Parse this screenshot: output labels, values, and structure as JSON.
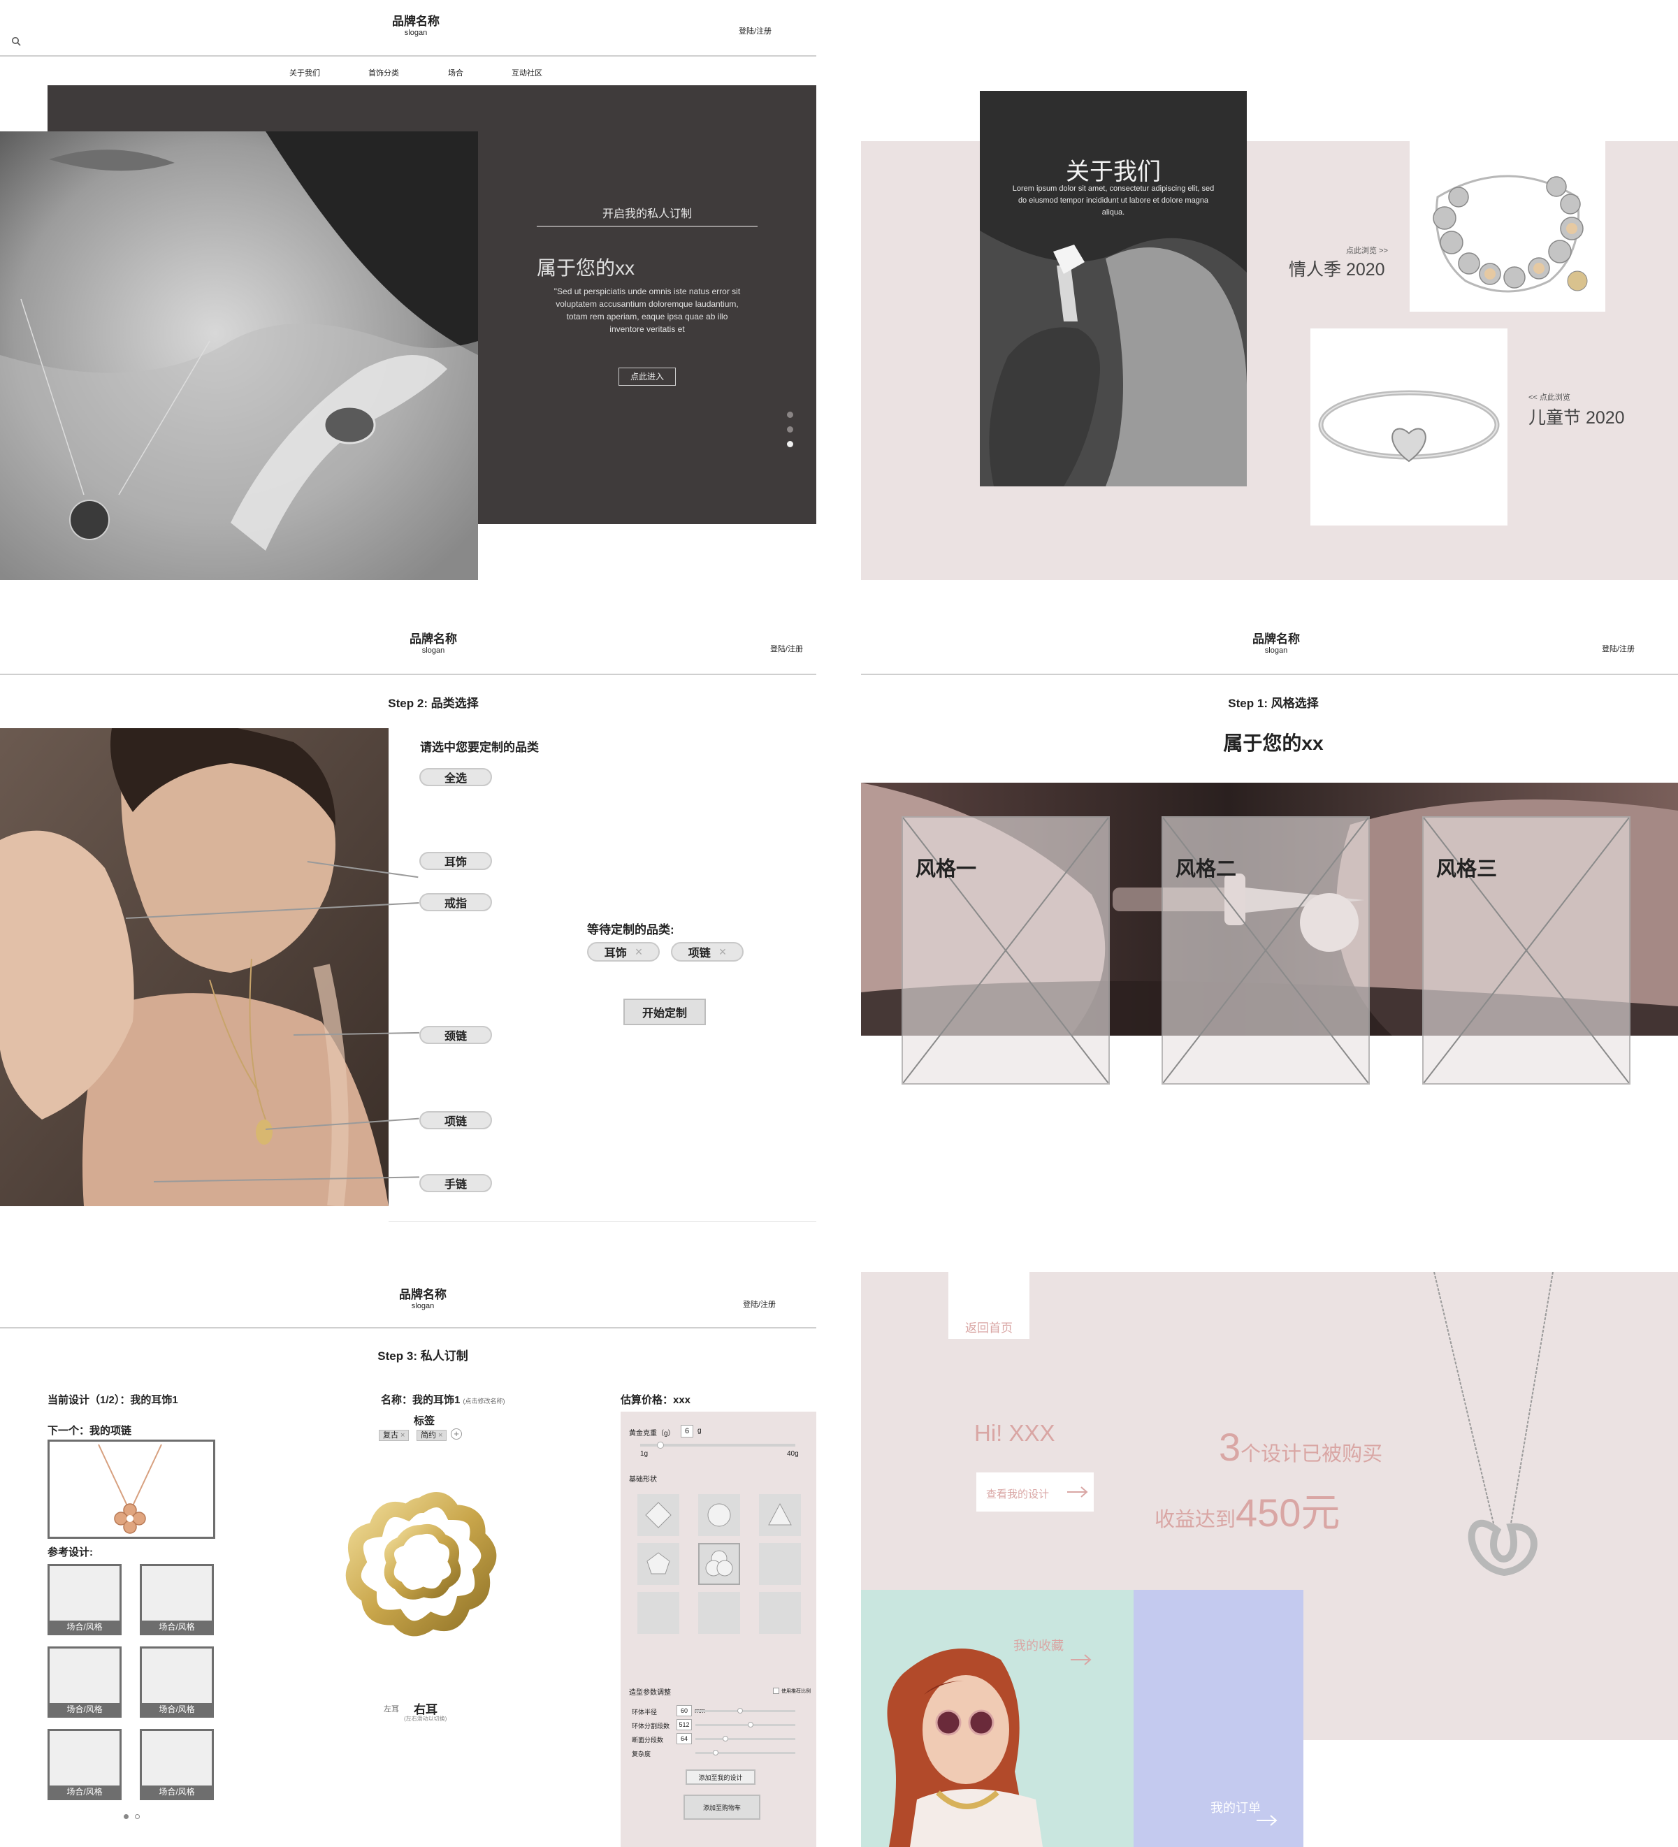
{
  "panel1": {
    "brand": "品牌名称",
    "slogan": "slogan",
    "login": "登陆/注册",
    "nav": [
      "关于我们",
      "首饰分类",
      "场合",
      "互动社区"
    ],
    "hero_heading": "开启我的私人订制",
    "hero_title": "属于您的xx",
    "hero_quote": "\"Sed ut perspiciatis unde omnis iste natus error sit voluptatem accusantium doloremque laudantium, totam rem aperiam, eaque ipsa quae ab illo inventore veritatis et",
    "hero_button": "点此进入",
    "carousel_dots": 3
  },
  "panel2": {
    "about_title": "关于我们",
    "about_text": "Lorem ipsum dolor sit amet, consectetur adipiscing elit, sed do eiusmod tempor incididunt ut labore et dolore magna aliqua.",
    "promo1_link": "点此浏览 >>",
    "promo1_title": "情人季 2020",
    "promo2_link": "<< 点此浏览",
    "promo2_title": "儿童节 2020"
  },
  "panel3": {
    "brand": "品牌名称",
    "slogan": "slogan",
    "login": "登陆/注册",
    "step": "Step 2: 品类选择",
    "prompt": "请选中您要定制的品类",
    "select_all": "全选",
    "categories": [
      "耳饰",
      "戒指",
      "颈链",
      "项链",
      "手链"
    ],
    "pending_label": "等待定制的品类:",
    "pending_items": [
      "耳饰",
      "项链"
    ],
    "start_button": "开始定制"
  },
  "panel4": {
    "brand": "品牌名称",
    "slogan": "slogan",
    "login": "登陆/注册",
    "step": "Step 1: 风格选择",
    "title": "属于您的xx",
    "styles": [
      "风格一",
      "风格二",
      "风格三"
    ]
  },
  "panel5": {
    "brand": "品牌名称",
    "slogan": "slogan",
    "login": "登陆/注册",
    "step": "Step 3: 私人订制",
    "current_design": "当前设计（1/2）：我的耳饰1",
    "next": "下一个：我的项链",
    "reference": "参考设计:",
    "reference_caption": "场合/风格",
    "name_label": "名称：我的耳饰1",
    "name_hint": "(点击修改名称)",
    "tags_label": "标签",
    "tags": [
      "复古",
      "简约"
    ],
    "left_ear": "左耳",
    "right_ear": "右耳",
    "ear_hint": "(左右滑动以切换)",
    "price_label": "估算价格：xxx",
    "gold_weight_label": "黄金克重（g）",
    "gold_weight_value": "6",
    "gold_weight_unit": "g",
    "gold_min": "1g",
    "gold_max": "40g",
    "gold_fraction": 0.13,
    "base_shape_label": "基础形状",
    "param_label": "造型参数调整",
    "ratio_label": "使用推荐比例",
    "params": [
      {
        "name": "环体半径",
        "value": "60",
        "unit": "mm",
        "fraction": 0.45
      },
      {
        "name": "环体分割段数",
        "value": "512",
        "unit": "",
        "fraction": 0.55
      },
      {
        "name": "断面分段数",
        "value": "64",
        "unit": "",
        "fraction": 0.3
      },
      {
        "name": "复杂度",
        "value": "",
        "unit": "",
        "fraction": 0.2
      }
    ],
    "save_button": "添加至我的设计",
    "cart_button": "添加至购物车"
  },
  "panel6": {
    "back": "返回首页",
    "greeting": "Hi! XXX",
    "view_designs": "查看我的设计",
    "designs_count": "3",
    "designs_text": "个设计已被购买",
    "earnings_prefix": "收益达到",
    "earnings_value": "450元",
    "favorites": "我的收藏",
    "orders": "我的订单"
  },
  "colors": {
    "dark_panel": "#3f3b3b",
    "pink_bg": "#ebe2e2",
    "pink_text": "#d9a6a4",
    "mint": "#c9e6df",
    "lavender": "#c4caef"
  }
}
